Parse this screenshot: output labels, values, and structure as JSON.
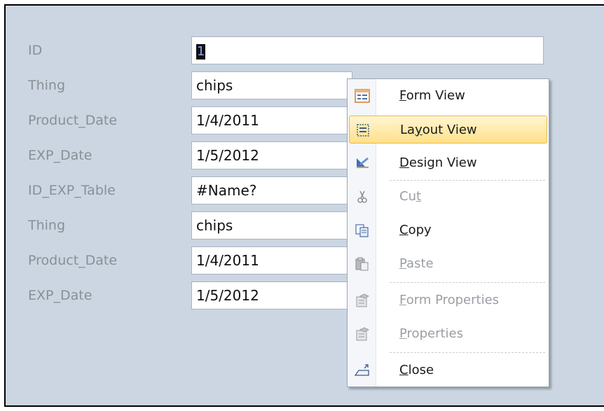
{
  "form": {
    "rows": [
      {
        "label": "ID",
        "value": "1"
      },
      {
        "label": "Thing",
        "value": "chips"
      },
      {
        "label": "Product_Date",
        "value": "1/4/2011"
      },
      {
        "label": "EXP_Date",
        "value": "1/5/2012"
      },
      {
        "label": "ID_EXP_Table",
        "value": "#Name?"
      },
      {
        "label": "Thing",
        "value": "chips"
      },
      {
        "label": "Product_Date",
        "value": "1/4/2011"
      },
      {
        "label": "EXP_Date",
        "value": "1/5/2012"
      }
    ]
  },
  "context_menu": {
    "items": [
      {
        "pre": "",
        "ul": "F",
        "post": "orm View",
        "icon": "form-view-icon",
        "enabled": true
      },
      {
        "pre": "La",
        "ul": "y",
        "post": "out View",
        "icon": "layout-view-icon",
        "enabled": true,
        "highlighted": true
      },
      {
        "pre": "",
        "ul": "D",
        "post": "esign View",
        "icon": "design-view-icon",
        "enabled": true
      },
      {
        "pre": "Cu",
        "ul": "t",
        "post": "",
        "icon": "scissors-icon",
        "enabled": false
      },
      {
        "pre": "",
        "ul": "C",
        "post": "opy",
        "icon": "copy-icon",
        "enabled": true
      },
      {
        "pre": "",
        "ul": "P",
        "post": "aste",
        "icon": "paste-icon",
        "enabled": false
      },
      {
        "pre": "",
        "ul": "F",
        "post": "orm Properties",
        "icon": "form-properties-icon",
        "enabled": false
      },
      {
        "pre": "",
        "ul": "P",
        "post": "roperties",
        "icon": "properties-icon",
        "enabled": false
      },
      {
        "pre": "",
        "ul": "C",
        "post": "lose",
        "icon": "close-form-icon",
        "enabled": true
      }
    ]
  },
  "colors": {
    "form_background": "#cbd6e2",
    "label_text": "#8a8f96",
    "highlight": "#ffe08a"
  }
}
